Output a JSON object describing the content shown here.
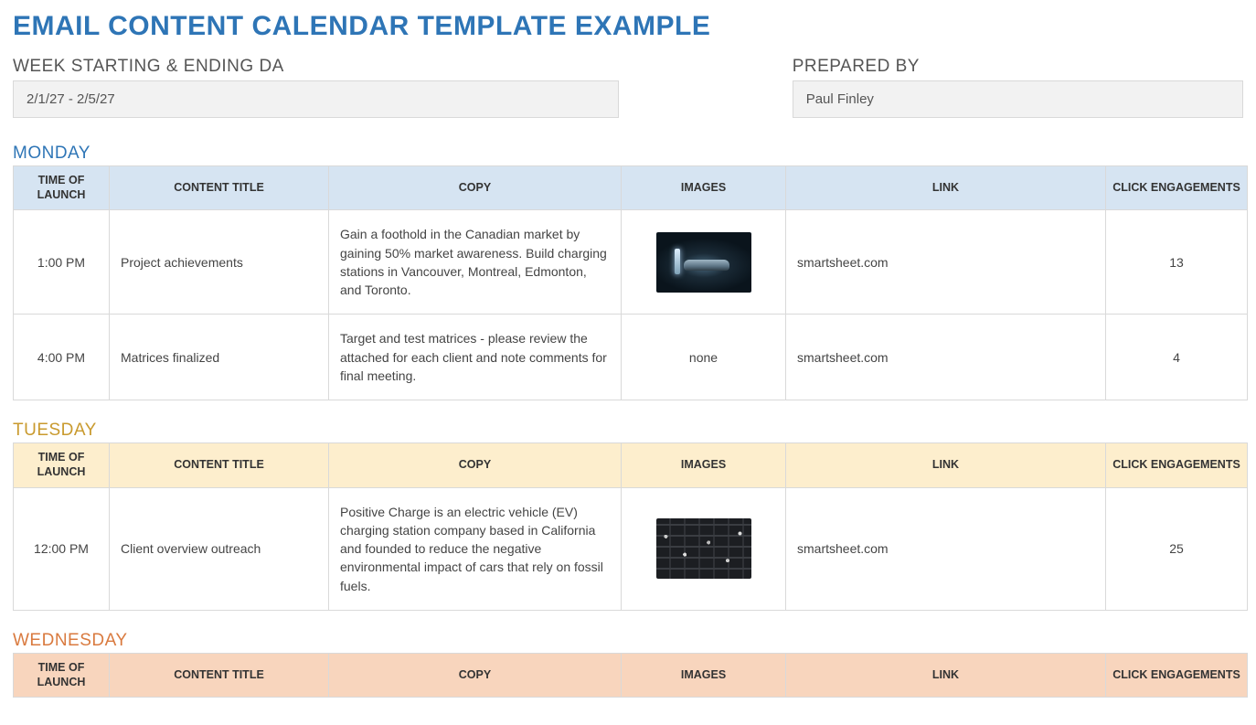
{
  "page_title": "EMAIL CONTENT CALENDAR TEMPLATE EXAMPLE",
  "meta": {
    "week_label": "WEEK STARTING & ENDING DA",
    "week_value": "2/1/27 - 2/5/27",
    "prepared_label": "PREPARED BY",
    "prepared_value": "Paul Finley"
  },
  "columns": {
    "time": "TIME OF LAUNCH",
    "title": "CONTENT TITLE",
    "copy": "COPY",
    "images": "IMAGES",
    "link": "LINK",
    "clicks": "CLICK ENGAGEMENTS"
  },
  "days": {
    "monday": {
      "heading": "MONDAY",
      "rows": [
        {
          "time": "1:00 PM",
          "title": "Project achievements",
          "copy": "Gain a foothold in the Canadian market by gaining 50% market awareness. Build charging stations in Vancouver, Montreal, Edmonton, and Toronto.",
          "image": "ev",
          "image_alt": "electric-vehicle-charging",
          "link": "smartsheet.com",
          "clicks": "13"
        },
        {
          "time": "4:00 PM",
          "title": "Matrices finalized",
          "copy": "Target and test matrices - please review the attached for each client and note comments for final meeting.",
          "image": "none",
          "image_alt": "",
          "link": "smartsheet.com",
          "clicks": "4"
        }
      ]
    },
    "tuesday": {
      "heading": "TUESDAY",
      "rows": [
        {
          "time": "12:00 PM",
          "title": "Client overview outreach",
          "copy": "Positive Charge is an electric vehicle (EV) charging station company based in California and founded to reduce the negative environmental impact of cars that rely on fossil fuels.",
          "image": "traffic",
          "image_alt": "traffic-jam-cars",
          "link": "smartsheet.com",
          "clicks": "25"
        }
      ]
    },
    "wednesday": {
      "heading": "WEDNESDAY",
      "rows": []
    }
  }
}
